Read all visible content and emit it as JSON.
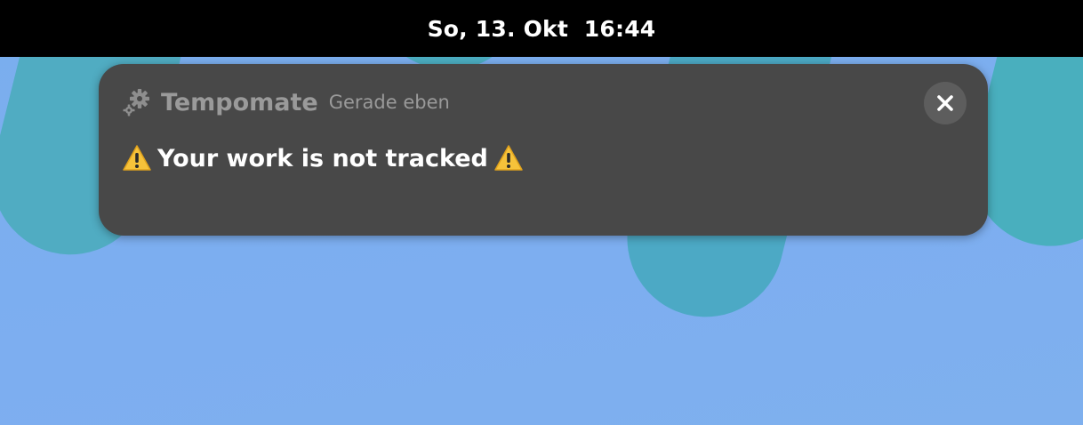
{
  "topbar": {
    "clock": "So, 13. Okt  16:44"
  },
  "notification": {
    "app_name": "Tempomate",
    "timestamp": "Gerade eben",
    "app_icon": "gears-icon",
    "message": "Your work is not tracked",
    "leading_icon": "warning-icon",
    "trailing_icon": "warning-icon",
    "close_icon": "close-icon"
  },
  "colors": {
    "topbar_bg": "#000000",
    "notification_bg": "#484848",
    "wallpaper": "#7aaeee",
    "wallpaper_shapes": "#4aaebd",
    "warning": "#f6c23a"
  }
}
